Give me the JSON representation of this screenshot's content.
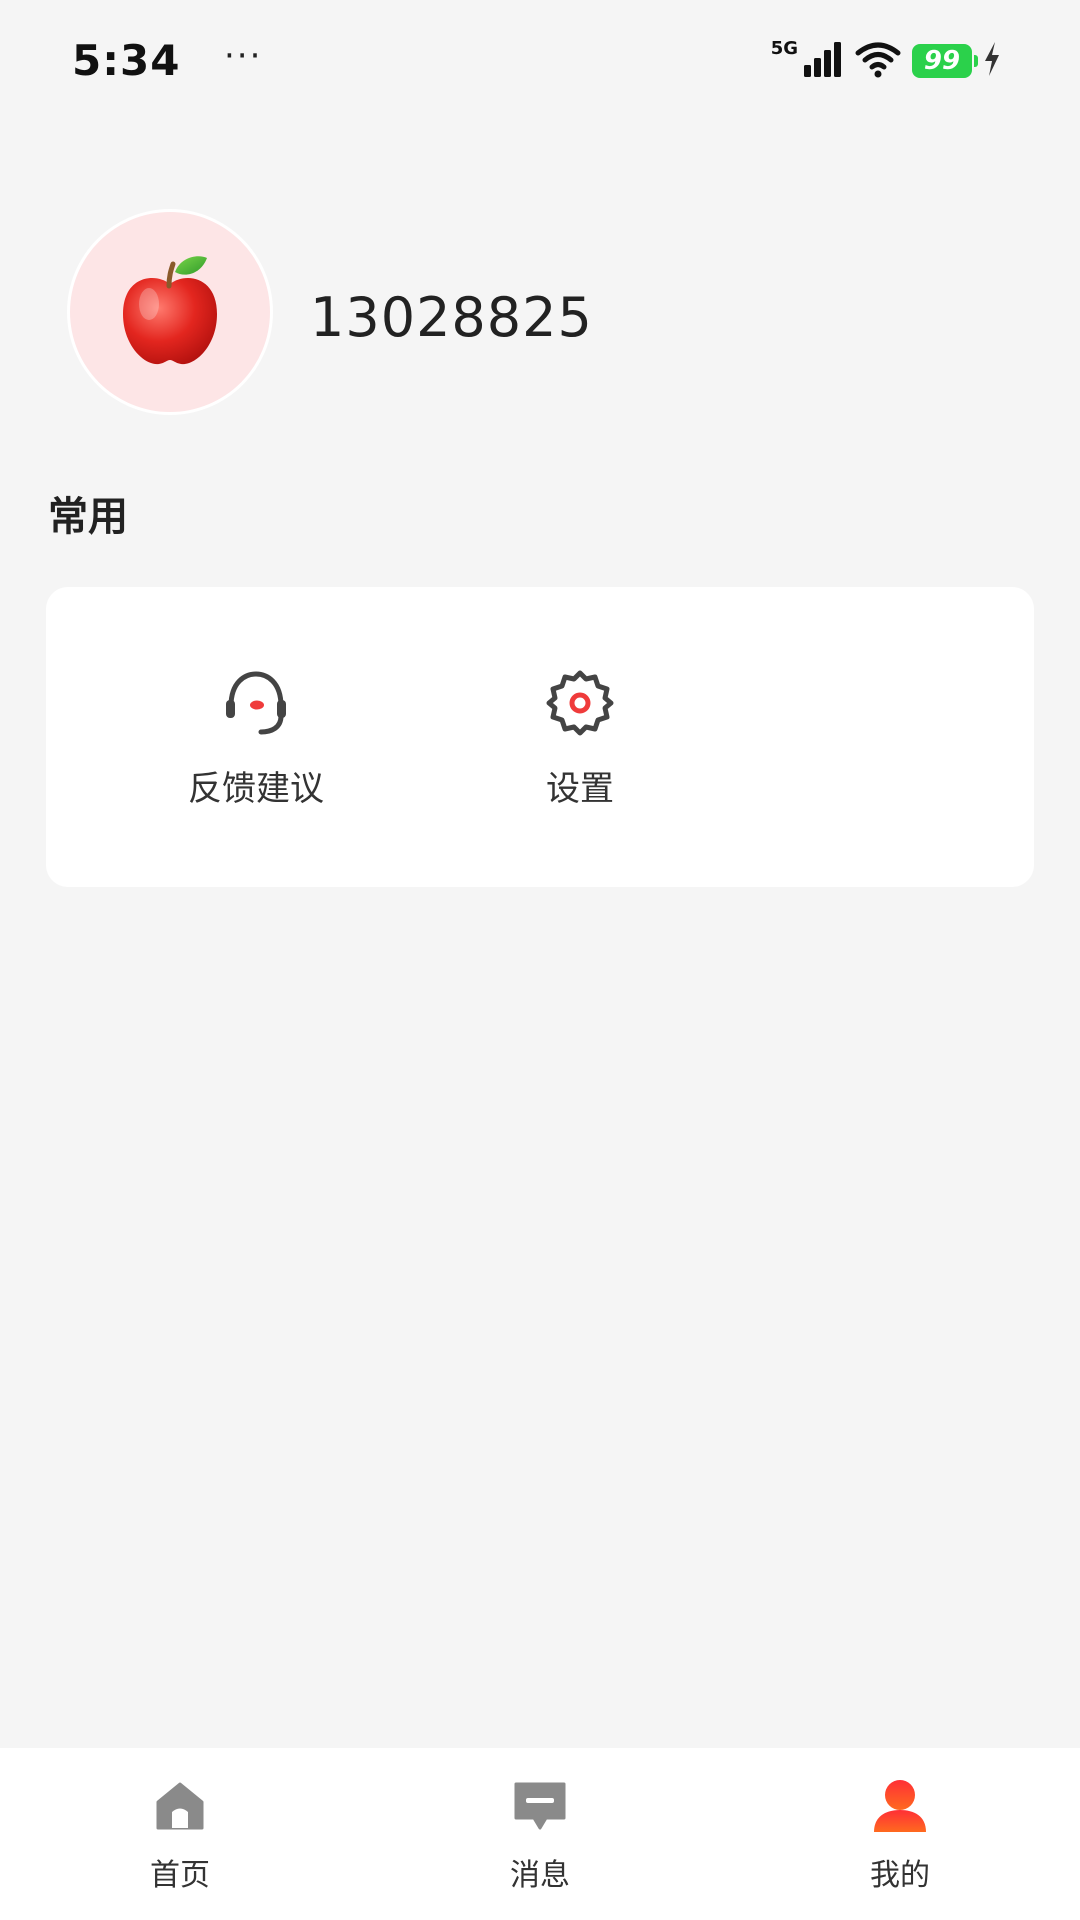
{
  "status_bar": {
    "time": "5:34",
    "more": "···",
    "network": "5G",
    "battery": "99"
  },
  "profile": {
    "avatar_icon": "apple-icon",
    "username": "13028825"
  },
  "section": {
    "title": "常用"
  },
  "shortcuts": [
    {
      "label": "反馈建议",
      "icon": "headset-icon"
    },
    {
      "label": "设置",
      "icon": "gear-icon"
    }
  ],
  "bottom_nav": [
    {
      "label": "首页",
      "icon": "home-icon",
      "active": false
    },
    {
      "label": "消息",
      "icon": "message-icon",
      "active": false
    },
    {
      "label": "我的",
      "icon": "user-icon",
      "active": true
    }
  ],
  "colors": {
    "accent": "#ff3b2f",
    "battery": "#2bd14b",
    "icon_gray": "#8a8a8a",
    "background": "#f5f5f5"
  }
}
